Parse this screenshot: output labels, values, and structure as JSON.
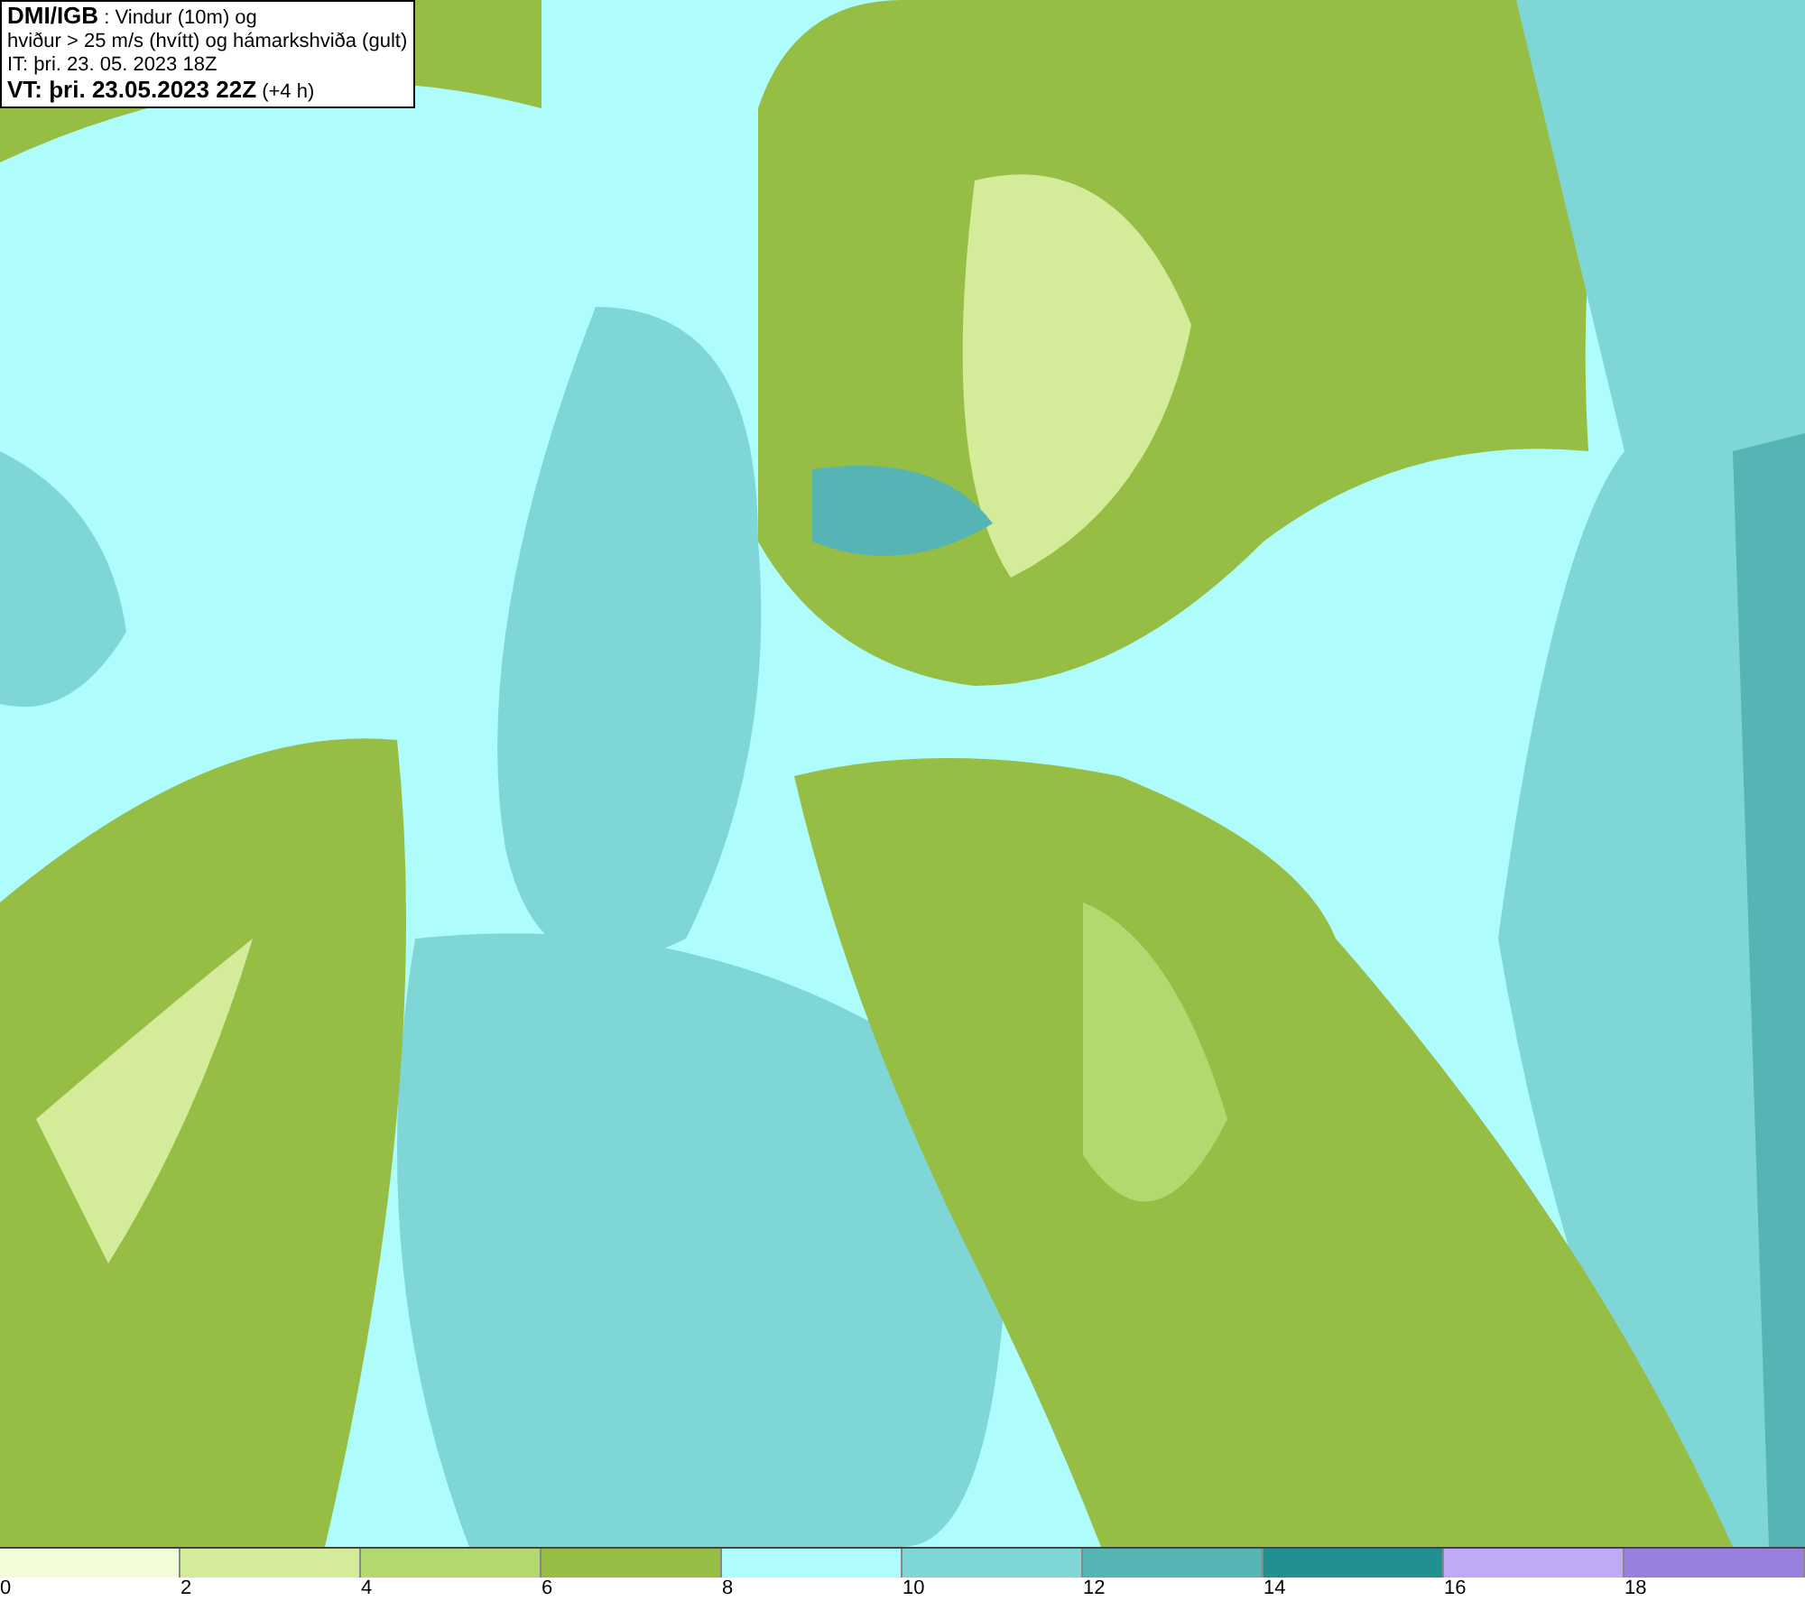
{
  "title_box": {
    "lines": [
      "**DMI/IGB** : Vindur (10m) og",
      "hviður > 25 m/s (hvítt) og hámarkshviða (gult)",
      "IT: þri. 23. 05. 2023 18Z",
      "**VT: þri. 23.05.2023 22Z** (+4 h)"
    ]
  },
  "legend": {
    "bins": [
      {
        "color": "#f2fcd9",
        "label": "0"
      },
      {
        "color": "#d4ec9a",
        "label": "2"
      },
      {
        "color": "#b4d870",
        "label": "4"
      },
      {
        "color": "#96be44",
        "label": "6"
      },
      {
        "color": "#aefcfc",
        "label": "8"
      },
      {
        "color": "#7ed6d6",
        "label": "10"
      },
      {
        "color": "#56b4b4",
        "label": "12"
      },
      {
        "color": "#229090",
        "label": "14"
      },
      {
        "color": "#c0aaf6",
        "label": "16"
      },
      {
        "color": "#9a80de",
        "label": "18"
      }
    ]
  }
}
